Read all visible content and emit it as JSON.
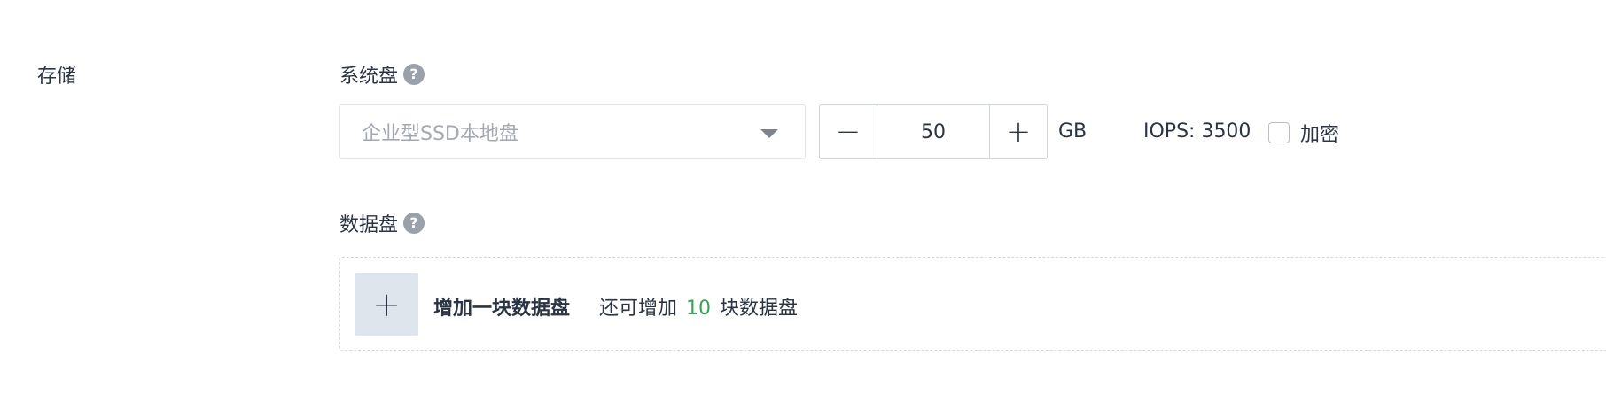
{
  "section": {
    "label": "存储"
  },
  "system_disk": {
    "title": "系统盘",
    "help_icon": "question-icon",
    "type_placeholder": "企业型SSD本地盘",
    "size": {
      "decrement": "−",
      "value": "50",
      "increment": "+",
      "unit": "GB"
    },
    "iops": "IOPS: 3500",
    "encrypt": {
      "label": "加密",
      "checked": false
    }
  },
  "data_disk": {
    "title": "数据盘",
    "help_icon": "question-icon",
    "add_icon": "+",
    "add_label": "增加一块数据盘",
    "remain_prefix": "还可增加",
    "remain_count": "10",
    "remain_suffix": "块数据盘",
    "remain_color": "#3aa15a"
  }
}
